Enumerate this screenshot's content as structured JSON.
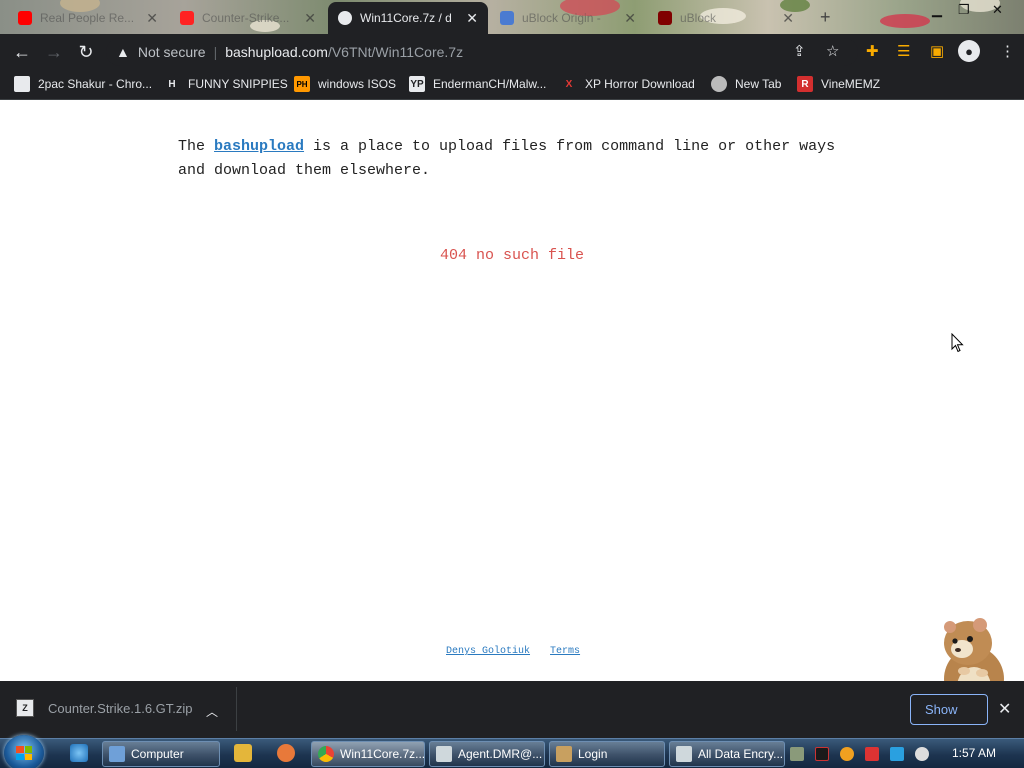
{
  "browser": {
    "tabs": [
      {
        "title": "Real People Re...",
        "favicon_color": "#ff0000",
        "active": false
      },
      {
        "title": "Counter-Strike...",
        "favicon_color": "#ff2222",
        "active": false
      },
      {
        "title": "Win11Core.7z / d",
        "favicon_color": "#e8eaed",
        "active": true
      },
      {
        "title": "uBlock Origin -",
        "favicon_color": "#4b7bd1",
        "active": false
      },
      {
        "title": "uBlock",
        "favicon_color": "#800000",
        "active": false
      }
    ],
    "new_tab_glyph": "+",
    "address": {
      "security_label": "Not secure",
      "host": "bashupload.com",
      "path": "/V6TNt/Win11Core.7z"
    },
    "bookmarks": [
      {
        "label": "2pac Shakur - Chro...",
        "icon": "chrome-store-icon",
        "icon_text": "",
        "icon_color": "#e8eaed"
      },
      {
        "label": "FUNNY SNIPPIES",
        "icon": "h-icon",
        "icon_text": "H",
        "icon_color": "#e8eaed"
      },
      {
        "label": "windows ISOS",
        "icon": "ph-icon",
        "icon_text": "PH",
        "icon_color": "#ff9800"
      },
      {
        "label": "EndermanCH/Malw...",
        "icon": "yp-icon",
        "icon_text": "YP",
        "icon_color": "#333333"
      },
      {
        "label": "XP Horror Download",
        "icon": "x-icon",
        "icon_text": "X",
        "icon_color": "#e53935"
      },
      {
        "label": "New Tab",
        "icon": "globe-icon",
        "icon_text": "",
        "icon_color": "#bbbbbb"
      },
      {
        "label": "VineMEMZ",
        "icon": "r-icon",
        "icon_text": "R",
        "icon_color": "#d32f2f"
      }
    ]
  },
  "page": {
    "intro_before": "The ",
    "intro_link": "bashupload",
    "intro_after": " is a place to upload files from command line or other ways and download them elsewhere.",
    "error": "404 no such file",
    "footer_links": [
      "Denys Golotiuk",
      "Terms"
    ]
  },
  "downloads": {
    "file_name": "Counter.Strike.1.6.GT.zip",
    "show_all_label": "Show",
    "close_glyph": "✕"
  },
  "taskbar": {
    "buttons": [
      {
        "label": "Computer",
        "icon_color": "#6fa0d8"
      },
      {
        "label": "Win11Core.7z...",
        "icon_color": "#e8eaed"
      },
      {
        "label": "Agent.DMR@...",
        "icon_color": "#cfd8dc"
      },
      {
        "label": "Login",
        "icon_color": "#c8a060"
      },
      {
        "label": "All Data Encry...",
        "icon_color": "#cfd8dc"
      }
    ],
    "clock": "1:57 AM"
  }
}
